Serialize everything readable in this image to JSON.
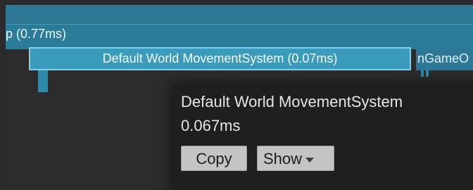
{
  "timeline": {
    "parent_label": "p (0.77ms)",
    "selected_sample": "Default World MovementSystem (0.07ms)",
    "right_sample": "nGameO"
  },
  "tooltip": {
    "name": "Default World MovementSystem",
    "duration": "0.067ms",
    "copy_label": "Copy",
    "show_label": "Show"
  },
  "icons": {
    "show_dropdown": "chevron-down-icon"
  },
  "colors": {
    "sample_bar": "#2b7c99",
    "selected_bar": "#3a9bbd",
    "selected_border": "#7fd2ee",
    "tooltip_bg": "#1f1f1f",
    "button_bg": "#c4c4c4"
  }
}
